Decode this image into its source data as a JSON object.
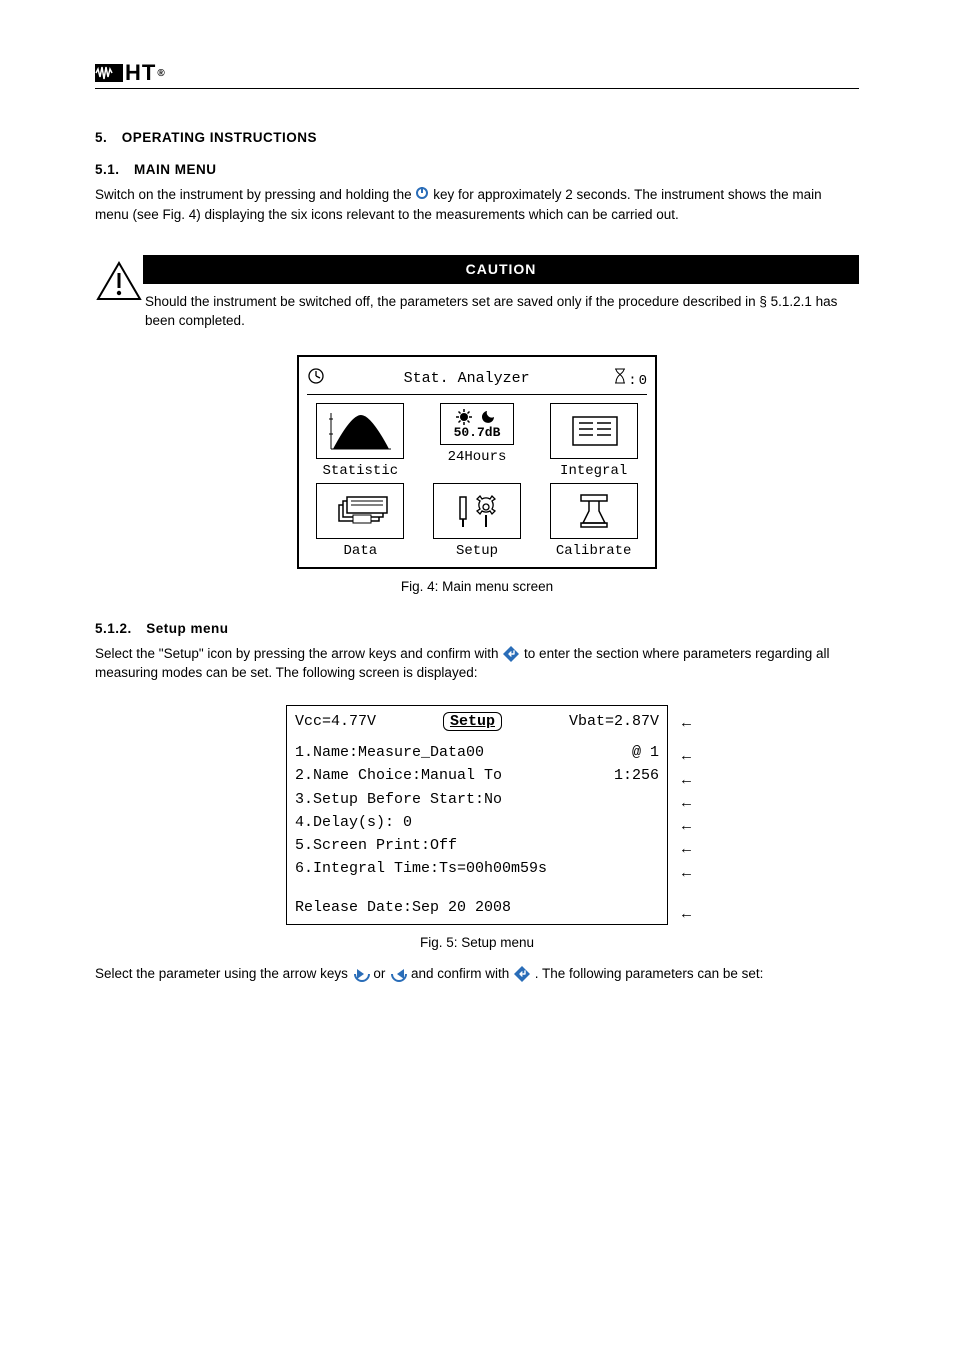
{
  "header": {
    "brand": "HT"
  },
  "section5": {
    "number": "5.",
    "title": "OPERATING INSTRUCTIONS",
    "subnumber": "5.1.",
    "subtitle": "MAIN MENU",
    "text_before": "Switch on the instrument by pressing and holding the ",
    "text_mid_icon_label": " key for approximately 2 seconds. The instrument shows the main menu (see Fig. 4) displaying the six icons relevant to the measurements which can be carried out.",
    "power_icon_name": "power-icon"
  },
  "caution": {
    "bar": "CAUTION",
    "text": "Should the instrument be switched off, the parameters set are saved only if the procedure described in § 5.1.2.1 has been completed."
  },
  "lcd_main": {
    "clock_icon": "clock-icon",
    "title": "Stat. Analyzer",
    "hourglass_icon": "hourglass-icon",
    "hourglass_value": "0",
    "icons": [
      {
        "name": "statistic-icon",
        "label": "Statistic"
      },
      {
        "name": "hours24-icon",
        "db": "50.7dB",
        "label": "24Hours"
      },
      {
        "name": "integral-icon",
        "label": "Integral"
      },
      {
        "name": "data-icon",
        "label": "Data"
      },
      {
        "name": "setup-icon",
        "label": "Setup"
      },
      {
        "name": "calibrate-icon",
        "label": "Calibrate"
      }
    ]
  },
  "fig4_caption": "Fig. 4: Main menu screen",
  "section512": {
    "number": "5.1.2.",
    "title": "Setup menu",
    "para1_a": "Select the \"Setup\" icon by pressing the arrow keys and confirm with ",
    "para1_b": " to enter the section where parameters regarding all measuring modes can be set. The following screen is displayed:"
  },
  "setup_screen": {
    "vcc": "Vcc=4.77V",
    "mid": "Setup",
    "vbat": "Vbat=2.87V",
    "lines": [
      {
        "left": "1.Name:Measure_Data00",
        "right": "@  1"
      },
      {
        "left": "2.Name Choice:Manual To",
        "right": "1:256"
      },
      {
        "left": "3.Setup Before Start:No",
        "right": ""
      },
      {
        "left": "4.Delay(s): 0",
        "right": ""
      },
      {
        "left": "5.Screen Print:Off",
        "right": ""
      },
      {
        "left": "6.Integral Time:Ts=00h00m59s",
        "right": ""
      }
    ],
    "release": "Release Date:Sep 20 2008",
    "arrows": [
      "←",
      "←",
      "←",
      "←",
      "←",
      "←",
      "←",
      " ",
      "←"
    ]
  },
  "fig5_caption": "Fig. 5: Setup menu",
  "final_para_a": "Select the parameter using the arrow keys ",
  "final_para_b": " or ",
  "final_para_c": " and confirm with ",
  "final_para_d": ". The following parameters can be set:"
}
